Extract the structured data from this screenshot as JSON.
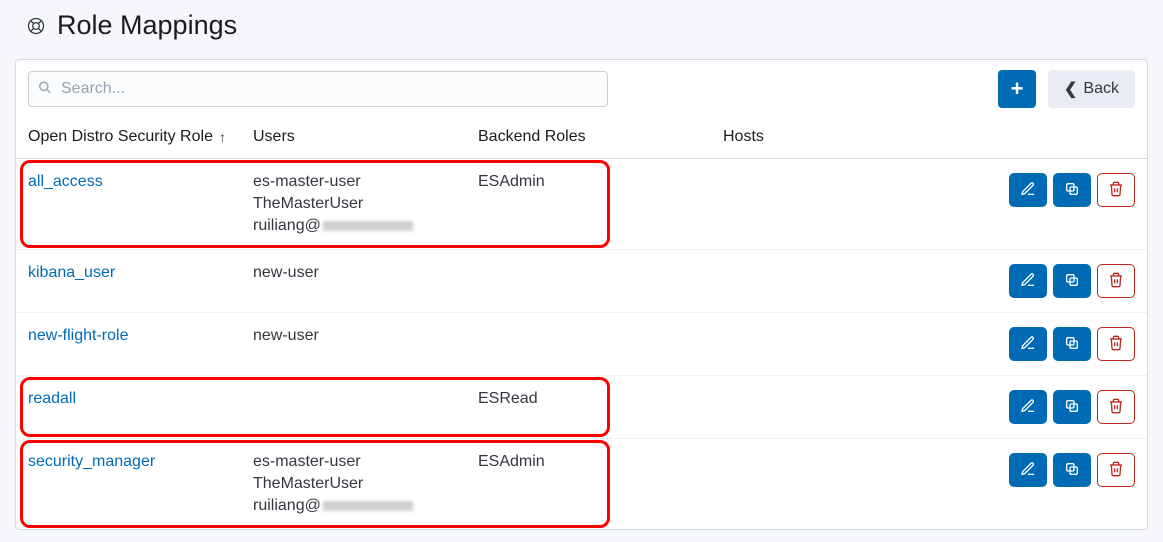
{
  "header": {
    "title": "Role Mappings"
  },
  "toolbar": {
    "search_placeholder": "Search...",
    "back_label": "Back"
  },
  "columns": {
    "role": "Open Distro Security Role",
    "users": "Users",
    "backend": "Backend Roles",
    "hosts": "Hosts"
  },
  "rows": [
    {
      "role": "all_access",
      "users": [
        "es-master-user",
        "TheMasterUser",
        "ruiliang@"
      ],
      "users_redacted_last": true,
      "backend": "ESAdmin",
      "hosts": "",
      "highlighted": true
    },
    {
      "role": "kibana_user",
      "users": [
        "new-user"
      ],
      "users_redacted_last": false,
      "backend": "",
      "hosts": "",
      "highlighted": false
    },
    {
      "role": "new-flight-role",
      "users": [
        "new-user"
      ],
      "users_redacted_last": false,
      "backend": "",
      "hosts": "",
      "highlighted": false
    },
    {
      "role": "readall",
      "users": [],
      "users_redacted_last": false,
      "backend": "ESRead",
      "hosts": "",
      "highlighted": true
    },
    {
      "role": "security_manager",
      "users": [
        "es-master-user",
        "TheMasterUser",
        "ruiliang@"
      ],
      "users_redacted_last": true,
      "backend": "ESAdmin",
      "hosts": "",
      "highlighted": true
    }
  ]
}
